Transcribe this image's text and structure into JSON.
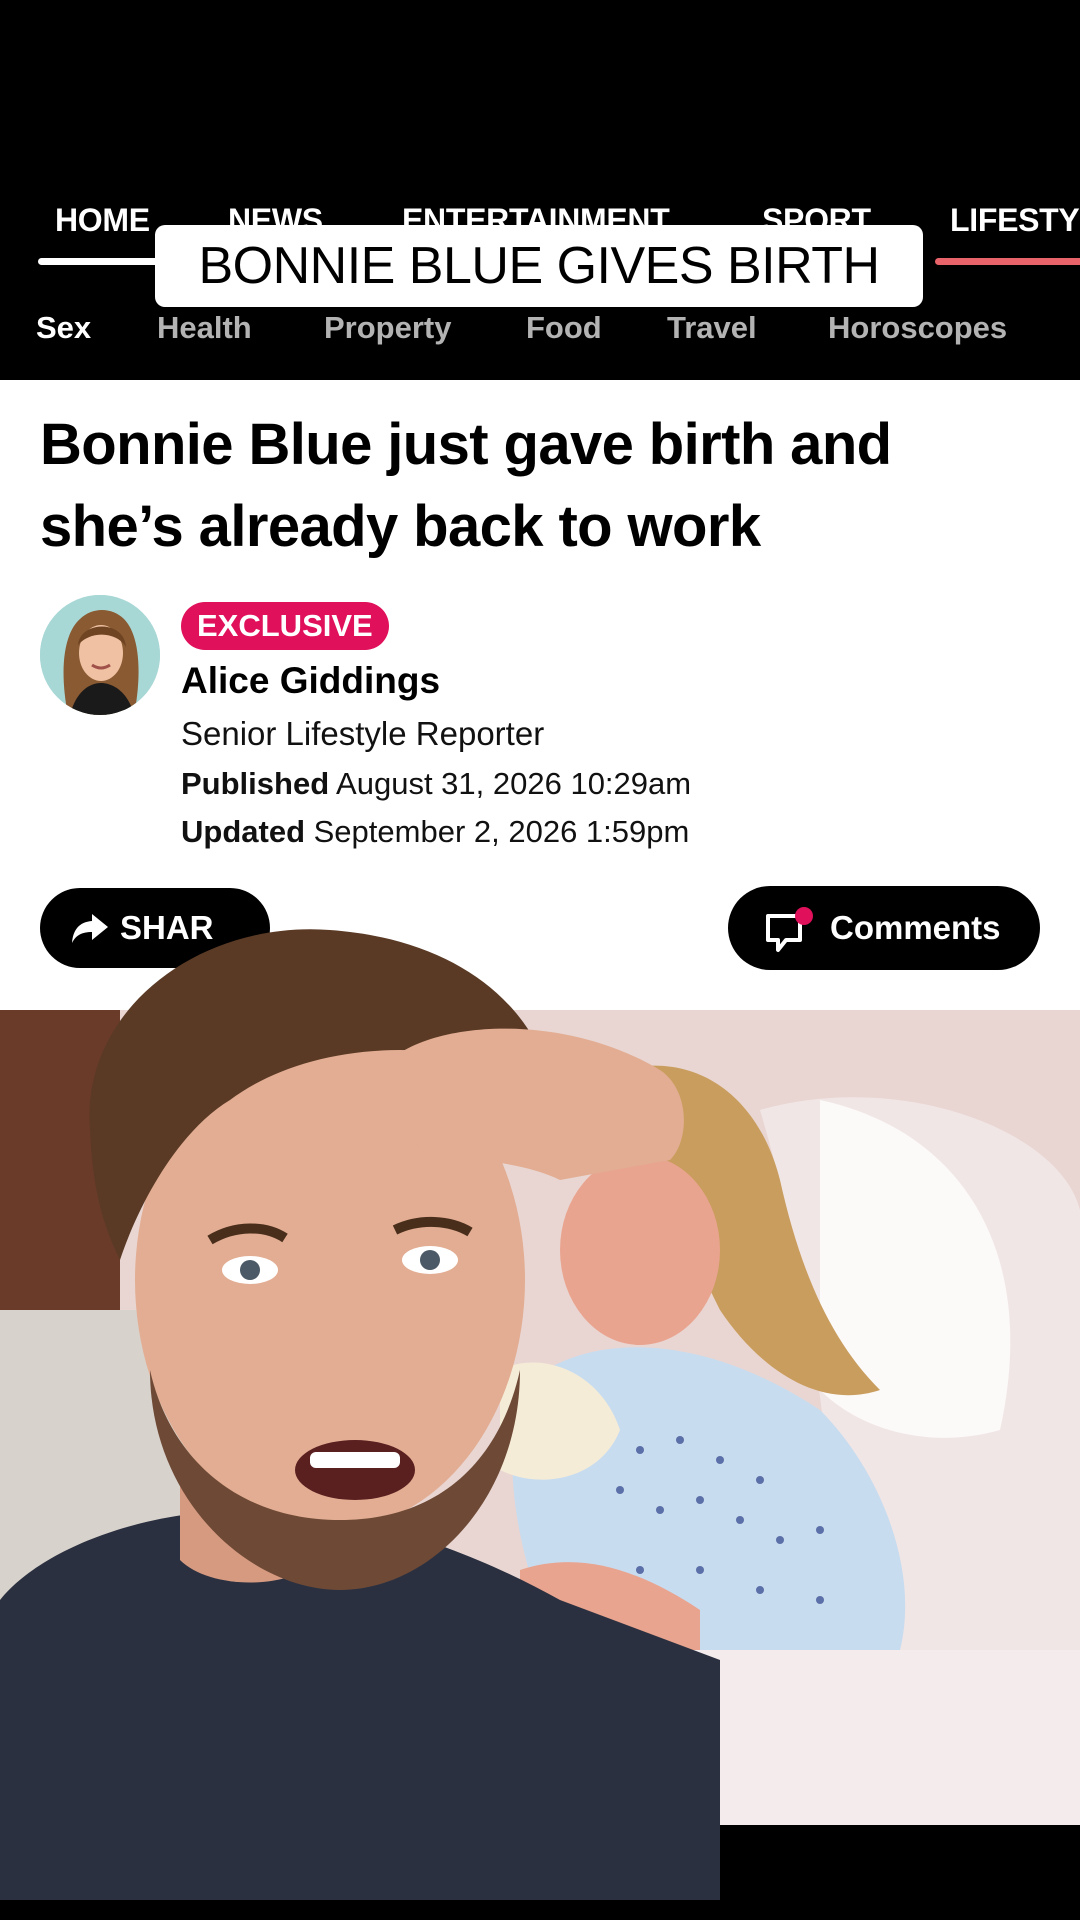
{
  "nav": {
    "items": [
      "HOME",
      "NEWS",
      "ENTERTAINMENT",
      "SPORT",
      "LIFESTY"
    ],
    "active_color": "#ffffff",
    "section_color": "#e8636a"
  },
  "caption": "BONNIE BLUE GIVES BIRTH",
  "subnav": {
    "items": [
      "Sex",
      "Health",
      "Property",
      "Food",
      "Travel",
      "Horoscopes"
    ]
  },
  "article": {
    "headline_line1": "Bonnie Blue just gave birth and",
    "headline_line2": "she’s already back to work",
    "badge": "EXCLUSIVE",
    "badge_color": "#e0105a",
    "author": "Alice Giddings",
    "role": "Senior Lifestyle Reporter",
    "published_label": "Published",
    "published_value": "August 31, 2026 10:29am",
    "updated_label": "Updated",
    "updated_value": "September 2, 2026 1:59pm",
    "share_label": "SHAR",
    "comments_label": "Comments",
    "comment_dot_color": "#e0105a"
  }
}
